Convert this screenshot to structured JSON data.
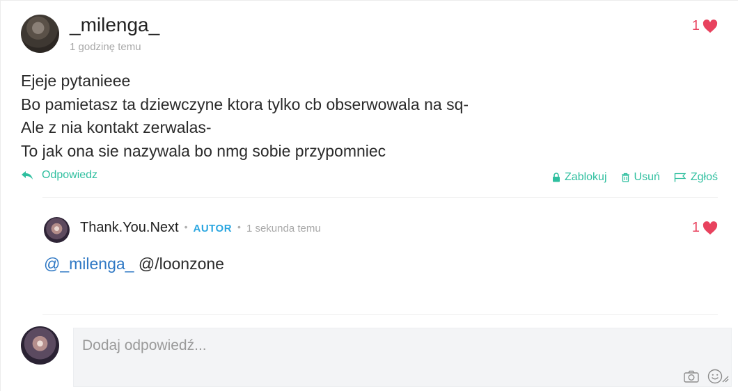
{
  "post": {
    "username": "_milenga_",
    "timestamp": "1 godzinę temu",
    "likes": "1",
    "lines": [
      "Ejeje pytanieee",
      "Bo pamietasz ta dziewczyne ktora tylko cb obserwowala na sq-",
      "Ale z nia kontakt zerwalas-",
      "To jak ona sie nazywala bo nmg sobie przypomniec"
    ],
    "reply_label": "Odpowiedz",
    "actions": {
      "block": "Zablokuj",
      "delete": "Usuń",
      "report": "Zgłoś"
    }
  },
  "reply": {
    "username": "Thank.You.Next",
    "separator": "•",
    "badge": "AUTOR",
    "timestamp": "1 sekunda temu",
    "likes": "1",
    "mention": "@_milenga_",
    "text": " @/loonzone"
  },
  "compose": {
    "placeholder": "Dodaj odpowiedź..."
  },
  "icons": {
    "heart": "heart-icon",
    "reply": "reply-arrow-icon",
    "block": "lock-icon",
    "delete": "trash-icon",
    "report": "flag-icon",
    "camera": "camera-icon",
    "emoji": "smiley-icon"
  },
  "colors": {
    "accent": "#2fbf9f",
    "heart": "#e8425e",
    "badge": "#2aa6e0",
    "mention": "#2f78c4"
  }
}
